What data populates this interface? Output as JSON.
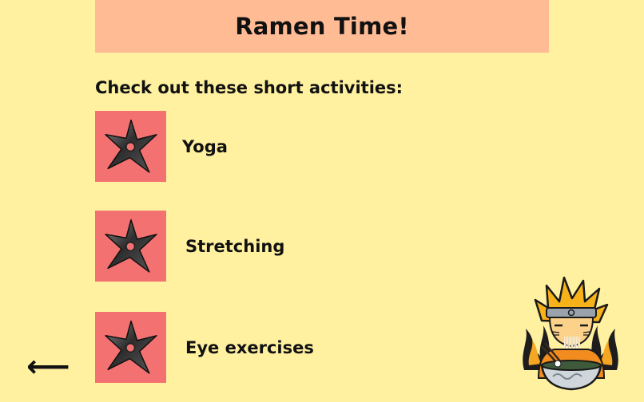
{
  "header": {
    "title": "Ramen Time!"
  },
  "intro": {
    "text": "Check out these short activities:"
  },
  "activities": [
    {
      "label": "Yoga",
      "icon": "shuriken-icon"
    },
    {
      "label": "Stretching",
      "icon": "shuriken-icon"
    },
    {
      "label": "Eye exercises",
      "icon": "shuriken-icon"
    }
  ],
  "nav": {
    "back_label": "⟵"
  },
  "colors": {
    "background": "#FFF1A0",
    "header": "#FFBB94",
    "tile": "#F47171"
  }
}
